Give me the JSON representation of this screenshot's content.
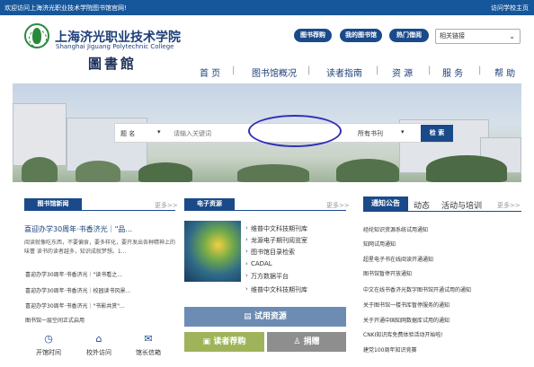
{
  "topbar": {
    "welcome": "欢迎访问上海济光职业技术学院图书馆官网!",
    "school_home": "访问学校主页"
  },
  "header": {
    "school_cn": "上海济光职业技术学院",
    "school_en": "Shanghai Jiguang Polytechnic College",
    "library_cn": "圖書館",
    "pills": [
      "图书荐购",
      "我的图书馆",
      "热门借阅"
    ],
    "links_select": "相关链接"
  },
  "nav": [
    "首 页",
    "图书馆概况",
    "读者指南",
    "资 源",
    "服 务",
    "帮 助"
  ],
  "search": {
    "scope": "题 名",
    "placeholder": "请输入关键词",
    "collection": "所有书刊",
    "button": "检 索"
  },
  "news": {
    "tag": "图书馆新闻",
    "more": "更多>>",
    "feature_title": "喜迎办学30周年·书香济光｜\"品...",
    "feature_summary": "阅读就像吃东西，不要偏食，要多样化，要开发出各种精神上的味蕾 读书的读者越多，知识成就梦想。1...",
    "items": [
      "喜迎办学30周年·书香济光｜\"读书看之...",
      "喜迎办学30周年·书香济光｜校园读书风景...",
      "喜迎办学30周年·书香济光｜\"书影共赏\"...",
      "图书馆一层空间正式启用"
    ],
    "bottom": [
      {
        "icon": "clock-icon",
        "label": "开馆时间"
      },
      {
        "icon": "home-icon",
        "label": "校外访问"
      },
      {
        "icon": "mail-icon",
        "label": "馆长信箱"
      }
    ]
  },
  "eres": {
    "tag": "电子资源",
    "more": "更多>>",
    "items": [
      "维普中文科技期刊库",
      "龙源电子期刊阅览室",
      "图书馆目录检索",
      "CADAL",
      "万方数据平台",
      "维普中文科技期刊库"
    ],
    "trial_button": "试用资源",
    "reader_button": "读者荐购",
    "donate_button": "捐赠"
  },
  "notices": {
    "tabs": [
      "通知公告",
      "动态",
      "活动与培训"
    ],
    "more": "更多>>",
    "items": [
      "经纶知识资源系统试用通知",
      "知网试用通知",
      "超星电子书在线阅读开通通知",
      "图书馆暂停开放通知",
      "中文在线书香济光数字图书馆开通试用的通知",
      "关于图书馆一楼书库暂停服务的通知",
      "关于开通中国知网数据库试用的通知",
      "CNKI知识库免费体验活动开始啦!",
      "建党100周年知识竞赛"
    ]
  },
  "colors": {
    "primary": "#1a4a8a",
    "topbar": "#16579b",
    "olive": "#9fb45a",
    "gray": "#8e8e8e",
    "slate": "#6d8cb4"
  }
}
